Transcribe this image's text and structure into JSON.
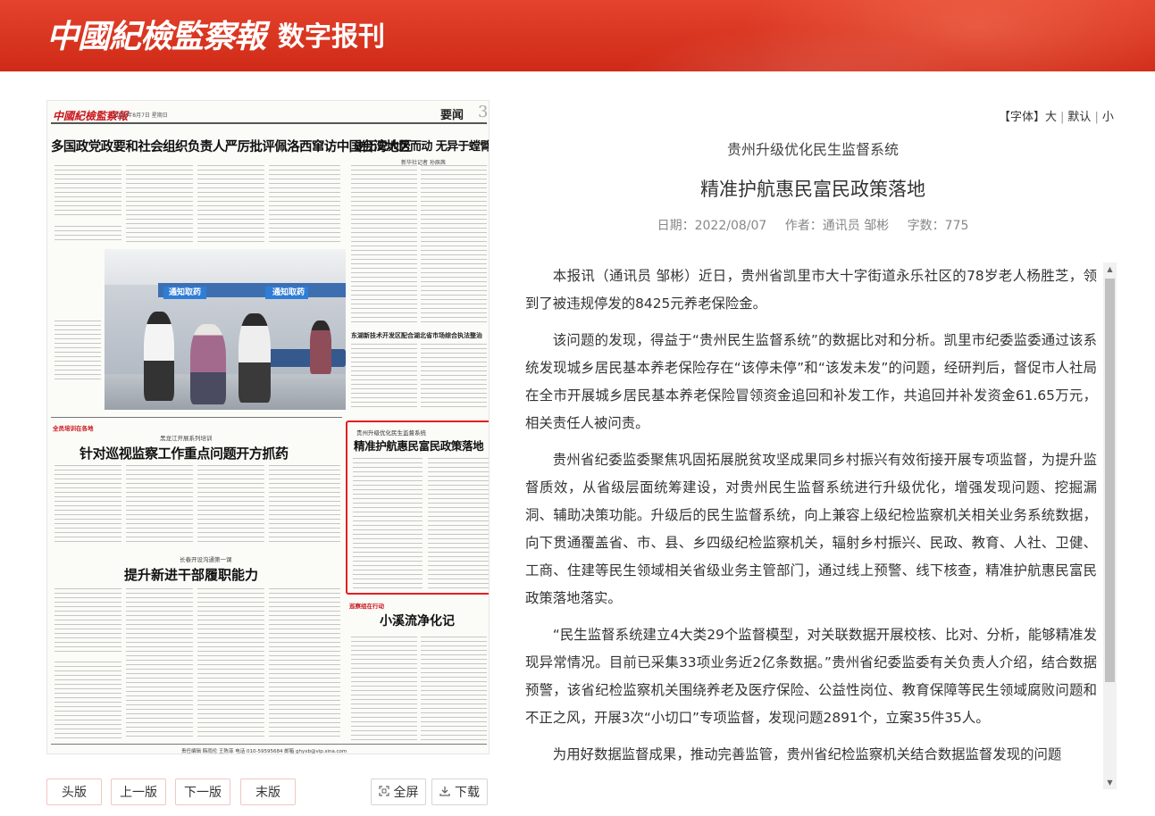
{
  "header": {
    "logo": "中國紀檢監察報",
    "subtitle": "数字报刊"
  },
  "newspaper": {
    "masthead": "中國紀檢監察報",
    "date": "2022年8月7日 星期日",
    "section": "要闻",
    "page_number": "3",
    "headline_main": "多国政党政要和社会组织负责人严厉批评佩洛西窜访中国台湾地区",
    "headline_right": "逆历史大势而动 无异于螳臂当车",
    "byline_right": "新华社记者 孙辰茜",
    "caption_right": "东湖新技术开发区配合湖北省市场综合执法整治",
    "tag_training": "全员培训在各地",
    "series_heilongjiang": "黑龙江开展系列培训",
    "headline_left": "针对巡视监察工作重点问题开方抓药",
    "series_changchun": "长春开设沟通第一课",
    "headline_left2": "提升新进干部履职能力",
    "highlight_sub": "贵州升级优化民生监督系统",
    "highlight_title": "精准护航惠民富民政策落地",
    "tag_patrol": "巡察组在行动",
    "headline_stream": "小溪流净化记",
    "photo_signs": [
      "通知取药",
      "通知取药"
    ],
    "footer": "责任编辑 韩雨伦 王陈菲 电话 010-59595684 邮箱 ghyxb@vip.sina.com"
  },
  "nav": {
    "first": "头版",
    "prev": "上一版",
    "next": "下一版",
    "last": "末版",
    "fullscreen": "全屏",
    "download": "下载",
    "fullscreen_icon": "fullscreen-icon",
    "download_icon": "download-icon"
  },
  "font_control": {
    "label": "【字体】",
    "large": "大",
    "default": "默认",
    "small": "小"
  },
  "article": {
    "kicker": "贵州升级优化民生监督系统",
    "title": "精准护航惠民富民政策落地",
    "date_label": "日期：",
    "date": "2022/08/07",
    "author_label": "作者：",
    "author": "通讯员 邹彬",
    "wordcount_label": "字数：",
    "wordcount": "775",
    "paragraphs": [
      "本报讯（通讯员 邹彬）近日，贵州省凯里市大十字街道永乐社区的78岁老人杨胜芝，领到了被违规停发的8425元养老保险金。",
      "该问题的发现，得益于“贵州民生监督系统”的数据比对和分析。凯里市纪委监委通过该系统发现城乡居民基本养老保险存在“该停未停”和“该发未发”的问题，经研判后，督促市人社局在全市开展城乡居民基本养老保险冒领资金追回和补发工作，共追回并补发资金61.65万元，相关责任人被问责。",
      "贵州省纪委监委聚焦巩固拓展脱贫攻坚成果同乡村振兴有效衔接开展专项监督，为提升监督质效，从省级层面统筹建设，对贵州民生监督系统进行升级优化，增强发现问题、挖掘漏洞、辅助决策功能。升级后的民生监督系统，向上兼容上级纪检监察机关相关业务系统数据，向下贯通覆盖省、市、县、乡四级纪检监察机关，辐射乡村振兴、民政、教育、人社、卫健、工商、住建等民生领域相关省级业务主管部门，通过线上预警、线下核查，精准护航惠民富民政策落地落实。",
      "“民生监督系统建立4大类29个监督模型，对关联数据开展校核、比对、分析，能够精准发现异常情况。目前已采集33项业务近2亿条数据。”贵州省纪委监委有关负责人介绍，结合数据预警，该省纪检监察机关围绕养老及医疗保险、公益性岗位、教育保障等民生领域腐败问题和不正之风，开展3次“小切口”专项监督，发现问题2891个，立案35件35人。",
      "为用好数据监督成果，推动完善监管，贵州省纪检监察机关结合数据监督发现的问题"
    ]
  }
}
